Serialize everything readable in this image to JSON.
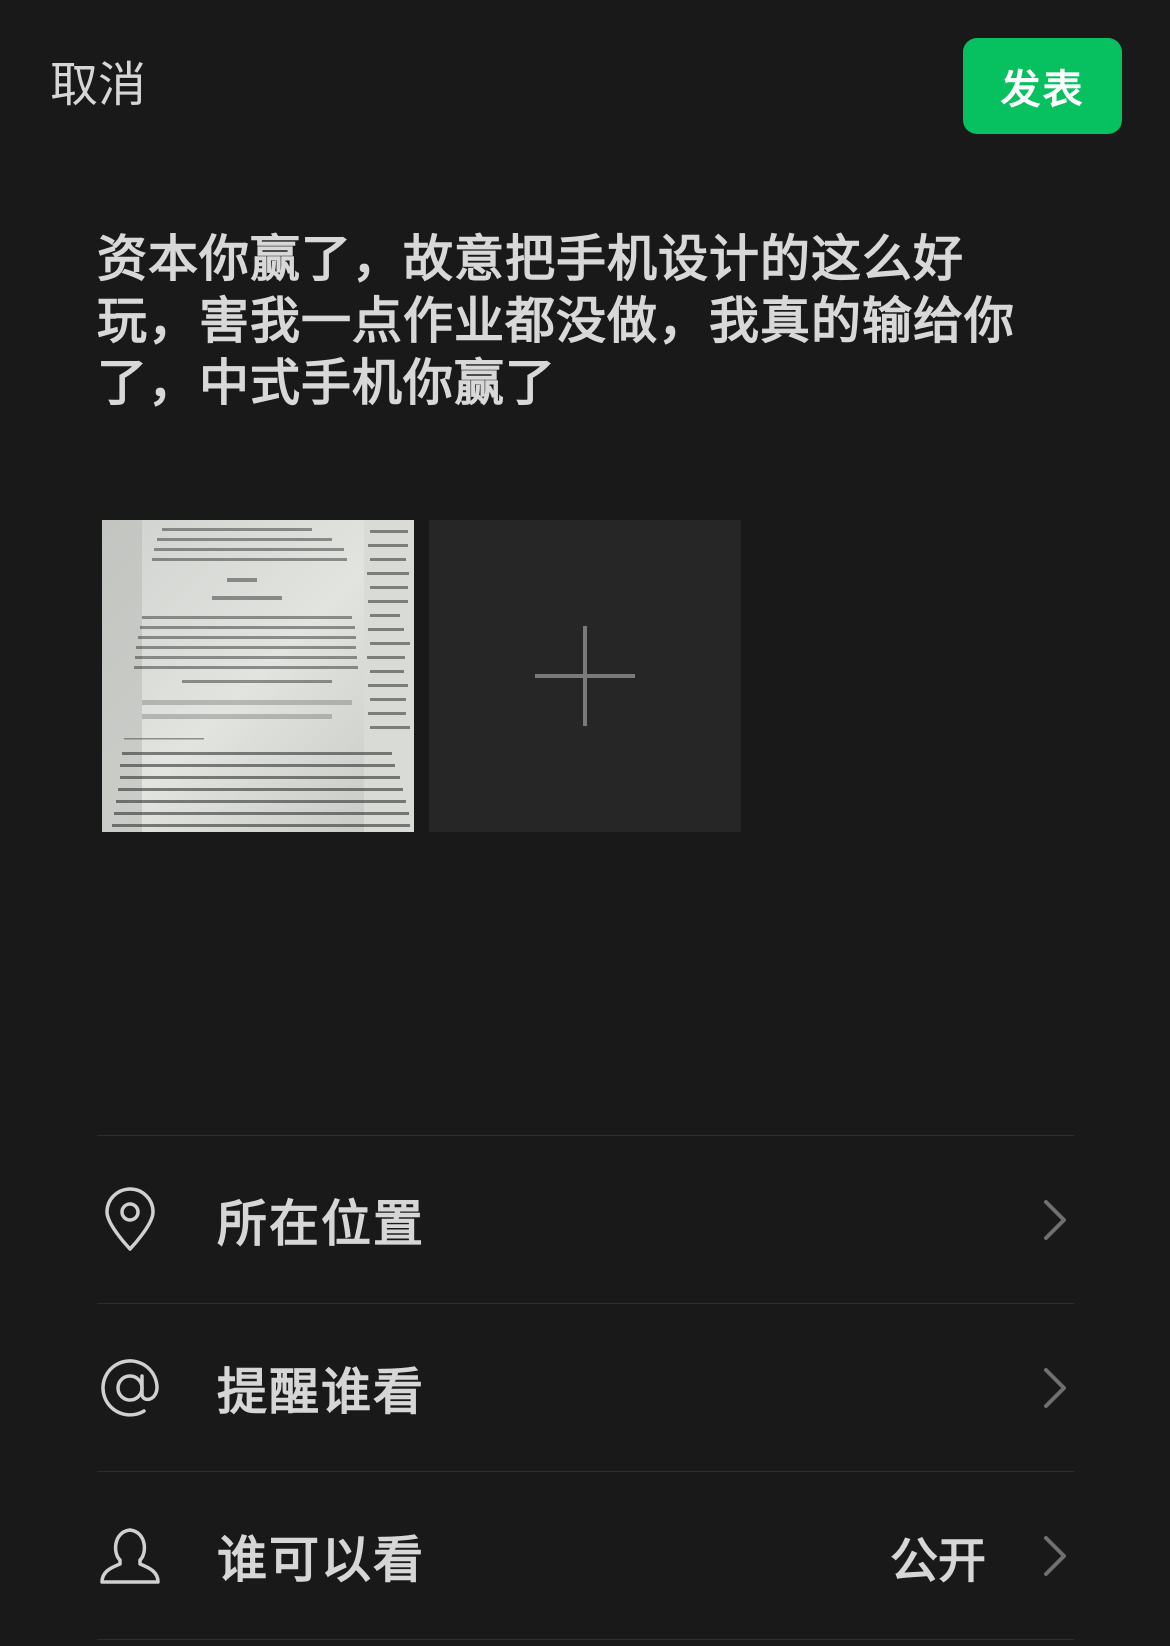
{
  "header": {
    "cancel_label": "取消",
    "publish_label": "发表"
  },
  "post": {
    "text": "资本你赢了，故意把手机设计的这么好玩，害我一点作业都没做，我真的输给你了，中式手机你赢了"
  },
  "media": {
    "photo_icon": "photo-thumbnail",
    "add_icon": "plus-icon"
  },
  "options": [
    {
      "label": "所在位置",
      "value": "",
      "icon": "location-pin-icon"
    },
    {
      "label": "提醒谁看",
      "value": "",
      "icon": "at-sign-icon"
    },
    {
      "label": "谁可以看",
      "value": "公开",
      "icon": "person-icon"
    }
  ],
  "colors": {
    "background": "#191919",
    "accent": "#07c160",
    "text": "#d6d6d6"
  }
}
